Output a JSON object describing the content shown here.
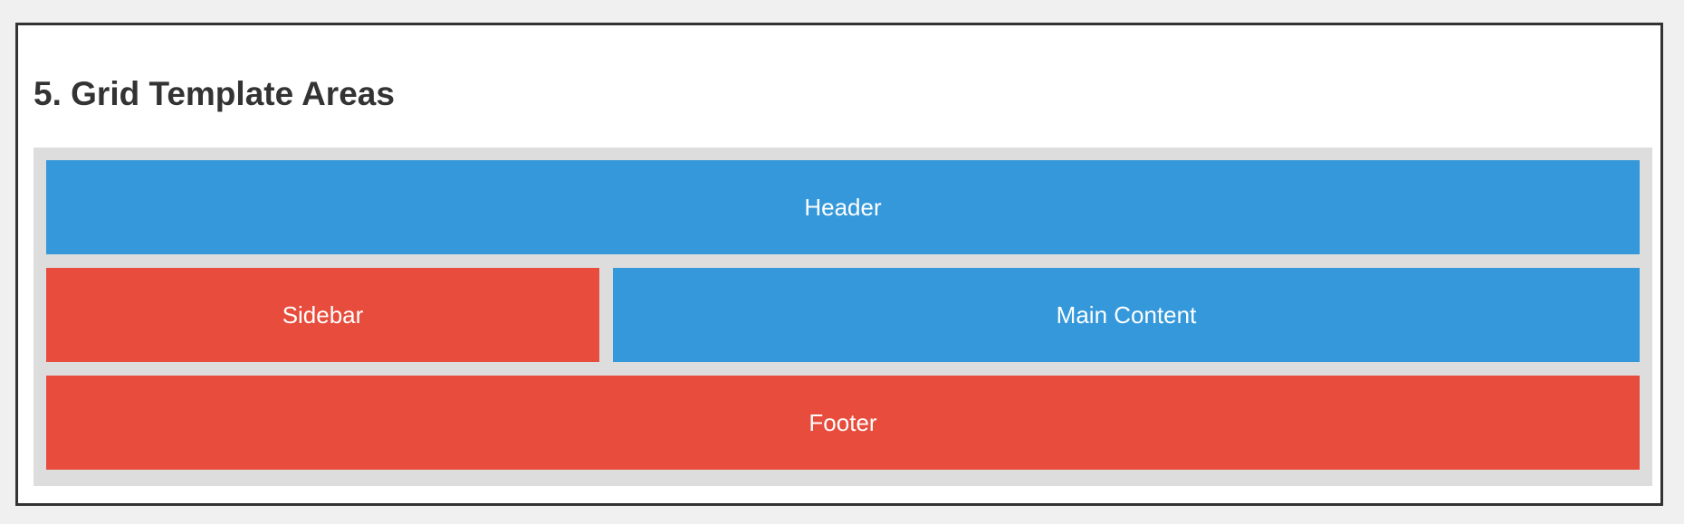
{
  "section": {
    "title": "5. Grid Template Areas"
  },
  "grid": {
    "header_label": "Header",
    "sidebar_label": "Sidebar",
    "main_label": "Main Content",
    "footer_label": "Footer"
  },
  "colors": {
    "page_background": "#f0f0f0",
    "panel_background": "#ffffff",
    "panel_border": "#333333",
    "grid_background": "#dddddd",
    "blue": "#3498db",
    "red": "#e74c3c",
    "text_dark": "#333333",
    "text_light": "#ffffff"
  }
}
